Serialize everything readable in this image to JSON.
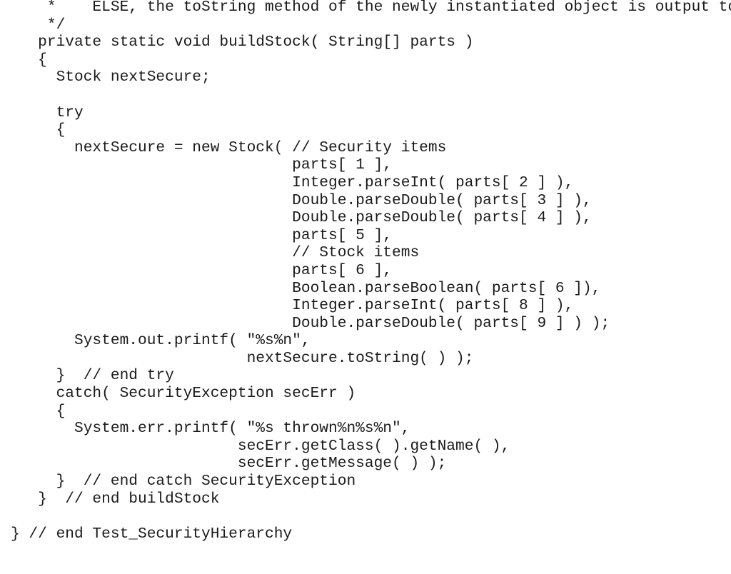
{
  "document": {
    "language": "java",
    "lines": [
      "    *    ELSE, the toString method of the newly instantiated object is output to",
      "    */",
      "   private static void buildStock( String[] parts )",
      "   {",
      "     Stock nextSecure;",
      "",
      "     try",
      "     {",
      "       nextSecure = new Stock( // Security items",
      "                               parts[ 1 ],",
      "                               Integer.parseInt( parts[ 2 ] ),",
      "                               Double.parseDouble( parts[ 3 ] ),",
      "                               Double.parseDouble( parts[ 4 ] ),",
      "                               parts[ 5 ],",
      "                               // Stock items",
      "                               parts[ 6 ],",
      "                               Boolean.parseBoolean( parts[ 6 ]),",
      "                               Integer.parseInt( parts[ 8 ] ),",
      "                               Double.parseDouble( parts[ 9 ] ) );",
      "       System.out.printf( \"%s%n\",",
      "                          nextSecure.toString( ) );",
      "     }  // end try",
      "     catch( SecurityException secErr )",
      "     {",
      "       System.err.printf( \"%s thrown%n%s%n\",",
      "                         secErr.getClass( ).getName( ),",
      "                         secErr.getMessage( ) );",
      "     }  // end catch SecurityException",
      "   }  // end buildStock",
      "",
      "} // end Test_SecurityHierarchy"
    ]
  }
}
